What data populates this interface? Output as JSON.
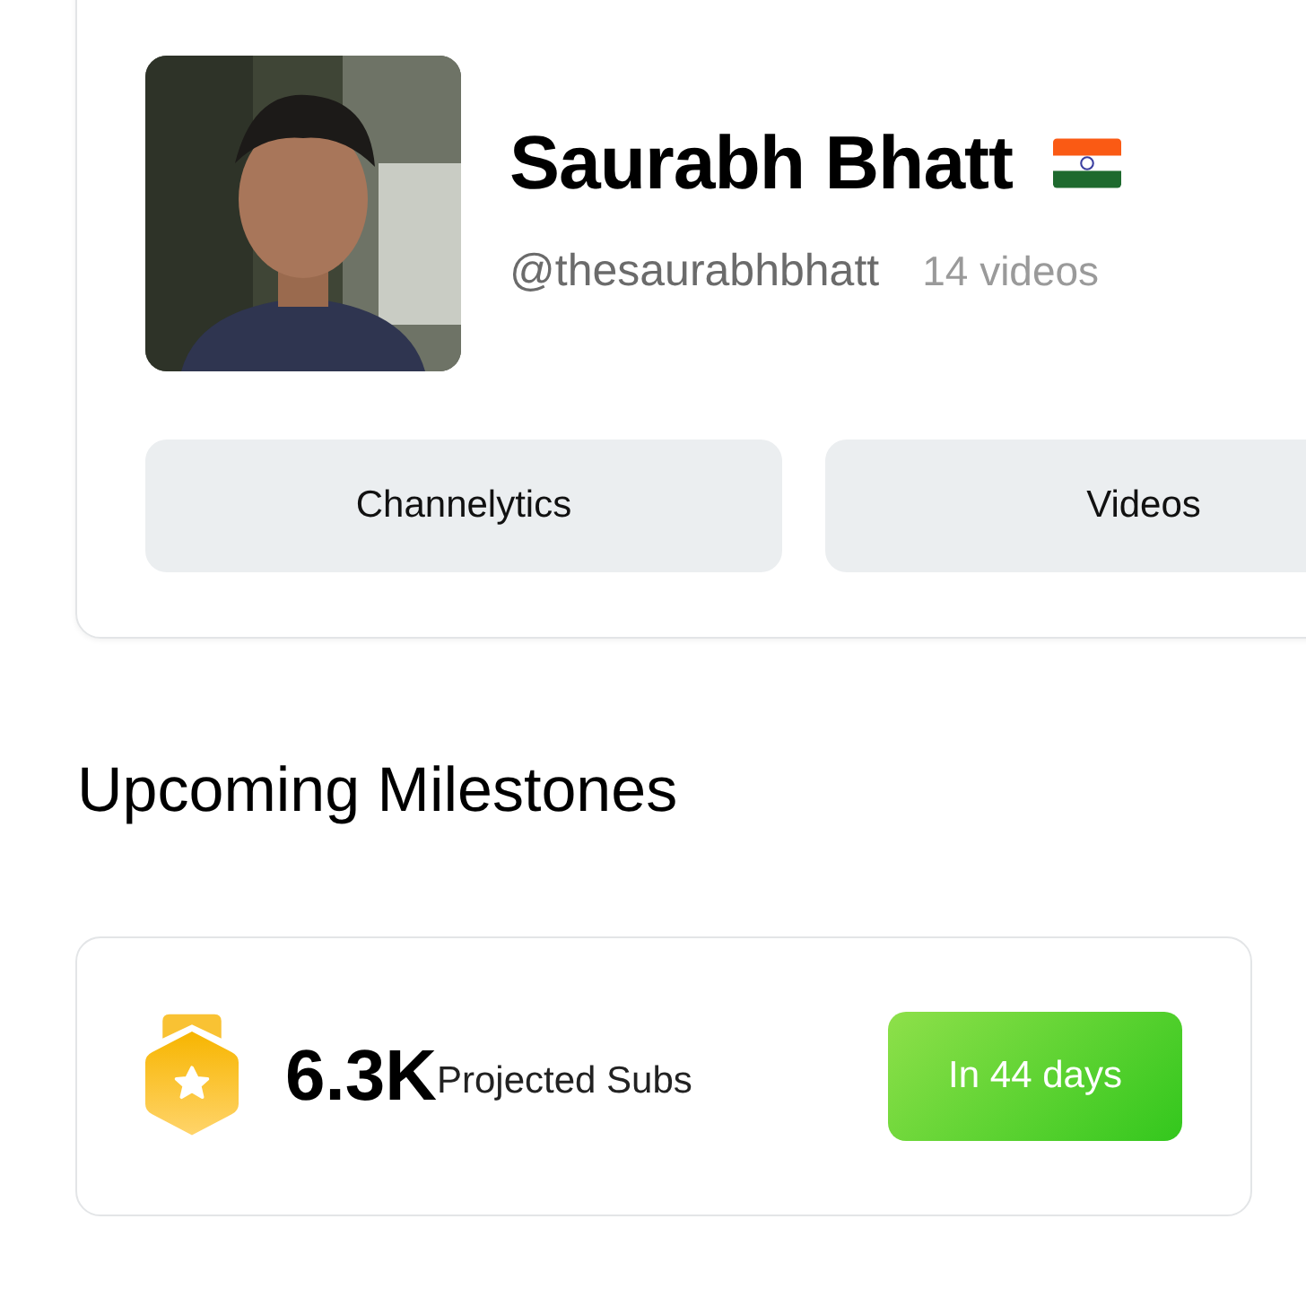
{
  "profile": {
    "name": "Saurabh Bhatt",
    "handle": "@thesaurabhbhatt",
    "video_count": "14 videos"
  },
  "tabs": [
    {
      "label": "Channelytics"
    },
    {
      "label": "Videos"
    }
  ],
  "section_title": "Upcoming Milestones",
  "milestones": [
    {
      "value": "6.3K",
      "label": "Projected Subs",
      "eta": "In 44 days"
    }
  ]
}
